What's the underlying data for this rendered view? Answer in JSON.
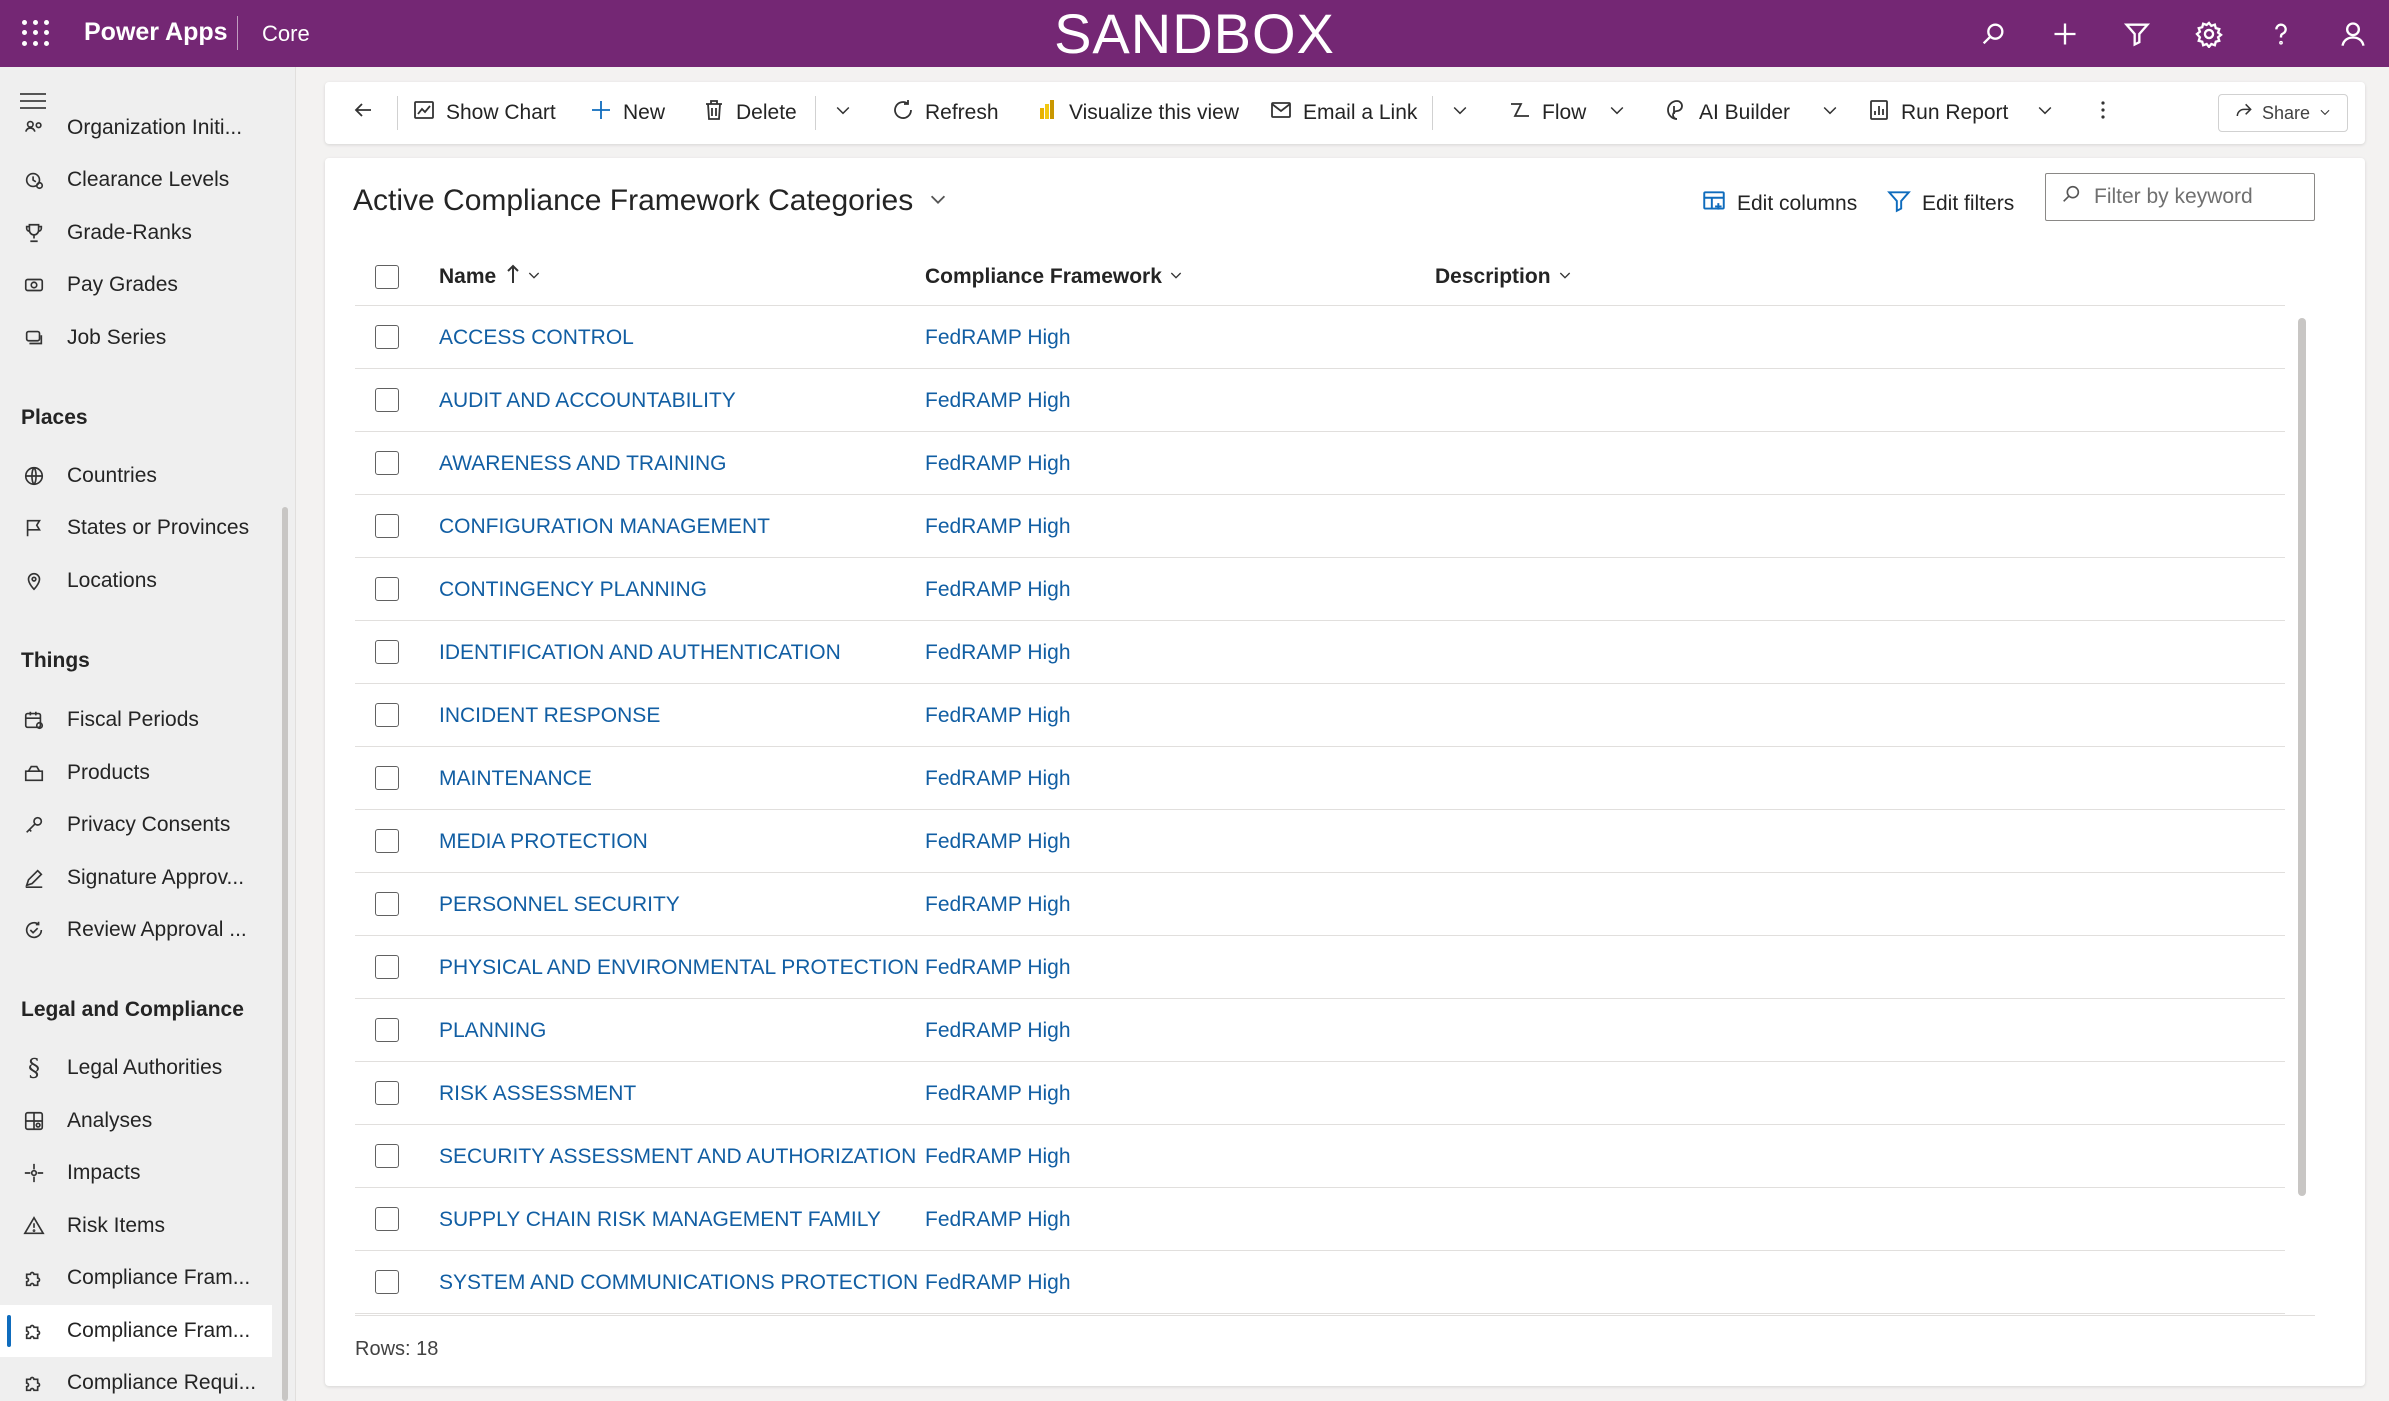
{
  "header": {
    "app_name": "Power Apps",
    "environment": "Core",
    "banner": "SANDBOX",
    "icons": [
      "search-icon",
      "plus-icon",
      "filter-icon",
      "gear-icon",
      "help-icon",
      "person-icon"
    ]
  },
  "sidebar": {
    "items_top": [
      {
        "label": "Organization Initi...",
        "icon": "organization-icon"
      },
      {
        "label": "Clearance Levels",
        "icon": "clearance-icon"
      },
      {
        "label": "Grade-Ranks",
        "icon": "trophy-icon"
      },
      {
        "label": "Pay Grades",
        "icon": "money-icon"
      },
      {
        "label": "Job Series",
        "icon": "stack-icon"
      }
    ],
    "groups": [
      {
        "title": "Places",
        "items": [
          {
            "label": "Countries",
            "icon": "globe-icon"
          },
          {
            "label": "States or Provinces",
            "icon": "flag-icon"
          },
          {
            "label": "Locations",
            "icon": "location-icon"
          }
        ]
      },
      {
        "title": "Things",
        "items": [
          {
            "label": "Fiscal Periods",
            "icon": "calendar-icon"
          },
          {
            "label": "Products",
            "icon": "box-icon"
          },
          {
            "label": "Privacy Consents",
            "icon": "key-icon"
          },
          {
            "label": "Signature Approv...",
            "icon": "pen-icon"
          },
          {
            "label": "Review Approval ...",
            "icon": "review-icon"
          }
        ]
      },
      {
        "title": "Legal and Compliance",
        "items": [
          {
            "label": "Legal Authorities",
            "icon": "section-icon"
          },
          {
            "label": "Analyses",
            "icon": "analysis-icon"
          },
          {
            "label": "Impacts",
            "icon": "impact-icon"
          },
          {
            "label": "Risk Items",
            "icon": "warning-icon"
          },
          {
            "label": "Compliance Fram...",
            "icon": "puzzle-icon"
          },
          {
            "label": "Compliance Fram...",
            "icon": "puzzle-icon",
            "selected": true
          },
          {
            "label": "Compliance Requi...",
            "icon": "puzzle-icon"
          }
        ]
      }
    ]
  },
  "commandbar": {
    "back_icon": "back-arrow-icon",
    "show_chart": "Show Chart",
    "new": "New",
    "delete": "Delete",
    "refresh": "Refresh",
    "visualize": "Visualize this view",
    "email_link": "Email a Link",
    "flow": "Flow",
    "ai_builder": "AI Builder",
    "run_report": "Run Report",
    "share": "Share"
  },
  "view": {
    "title": "Active Compliance Framework Categories",
    "edit_columns": "Edit columns",
    "edit_filters": "Edit filters",
    "filter_placeholder": "Filter by keyword",
    "filter_value": "",
    "columns": {
      "name": "Name",
      "framework": "Compliance Framework",
      "description": "Description"
    },
    "rows": [
      {
        "name": "ACCESS CONTROL",
        "framework": "FedRAMP High",
        "description": ""
      },
      {
        "name": "AUDIT AND ACCOUNTABILITY",
        "framework": "FedRAMP High",
        "description": ""
      },
      {
        "name": "AWARENESS AND TRAINING",
        "framework": "FedRAMP High",
        "description": ""
      },
      {
        "name": "CONFIGURATION MANAGEMENT",
        "framework": "FedRAMP High",
        "description": ""
      },
      {
        "name": "CONTINGENCY PLANNING",
        "framework": "FedRAMP High",
        "description": ""
      },
      {
        "name": "IDENTIFICATION AND AUTHENTICATION",
        "framework": "FedRAMP High",
        "description": ""
      },
      {
        "name": "INCIDENT RESPONSE",
        "framework": "FedRAMP High",
        "description": ""
      },
      {
        "name": "MAINTENANCE",
        "framework": "FedRAMP High",
        "description": ""
      },
      {
        "name": "MEDIA PROTECTION",
        "framework": "FedRAMP High",
        "description": ""
      },
      {
        "name": "PERSONNEL SECURITY",
        "framework": "FedRAMP High",
        "description": ""
      },
      {
        "name": "PHYSICAL AND ENVIRONMENTAL PROTECTION",
        "framework": "FedRAMP High",
        "description": ""
      },
      {
        "name": "PLANNING",
        "framework": "FedRAMP High",
        "description": ""
      },
      {
        "name": "RISK ASSESSMENT",
        "framework": "FedRAMP High",
        "description": ""
      },
      {
        "name": "SECURITY ASSESSMENT AND AUTHORIZATION",
        "framework": "FedRAMP High",
        "description": ""
      },
      {
        "name": "SUPPLY CHAIN RISK MANAGEMENT FAMILY",
        "framework": "FedRAMP High",
        "description": ""
      },
      {
        "name": "SYSTEM AND COMMUNICATIONS PROTECTION",
        "framework": "FedRAMP High",
        "description": ""
      }
    ],
    "row_count": "Rows: 18"
  },
  "colors": {
    "header_bg": "#742774",
    "link": "#115ea3",
    "accent": "#0f6cbd"
  }
}
